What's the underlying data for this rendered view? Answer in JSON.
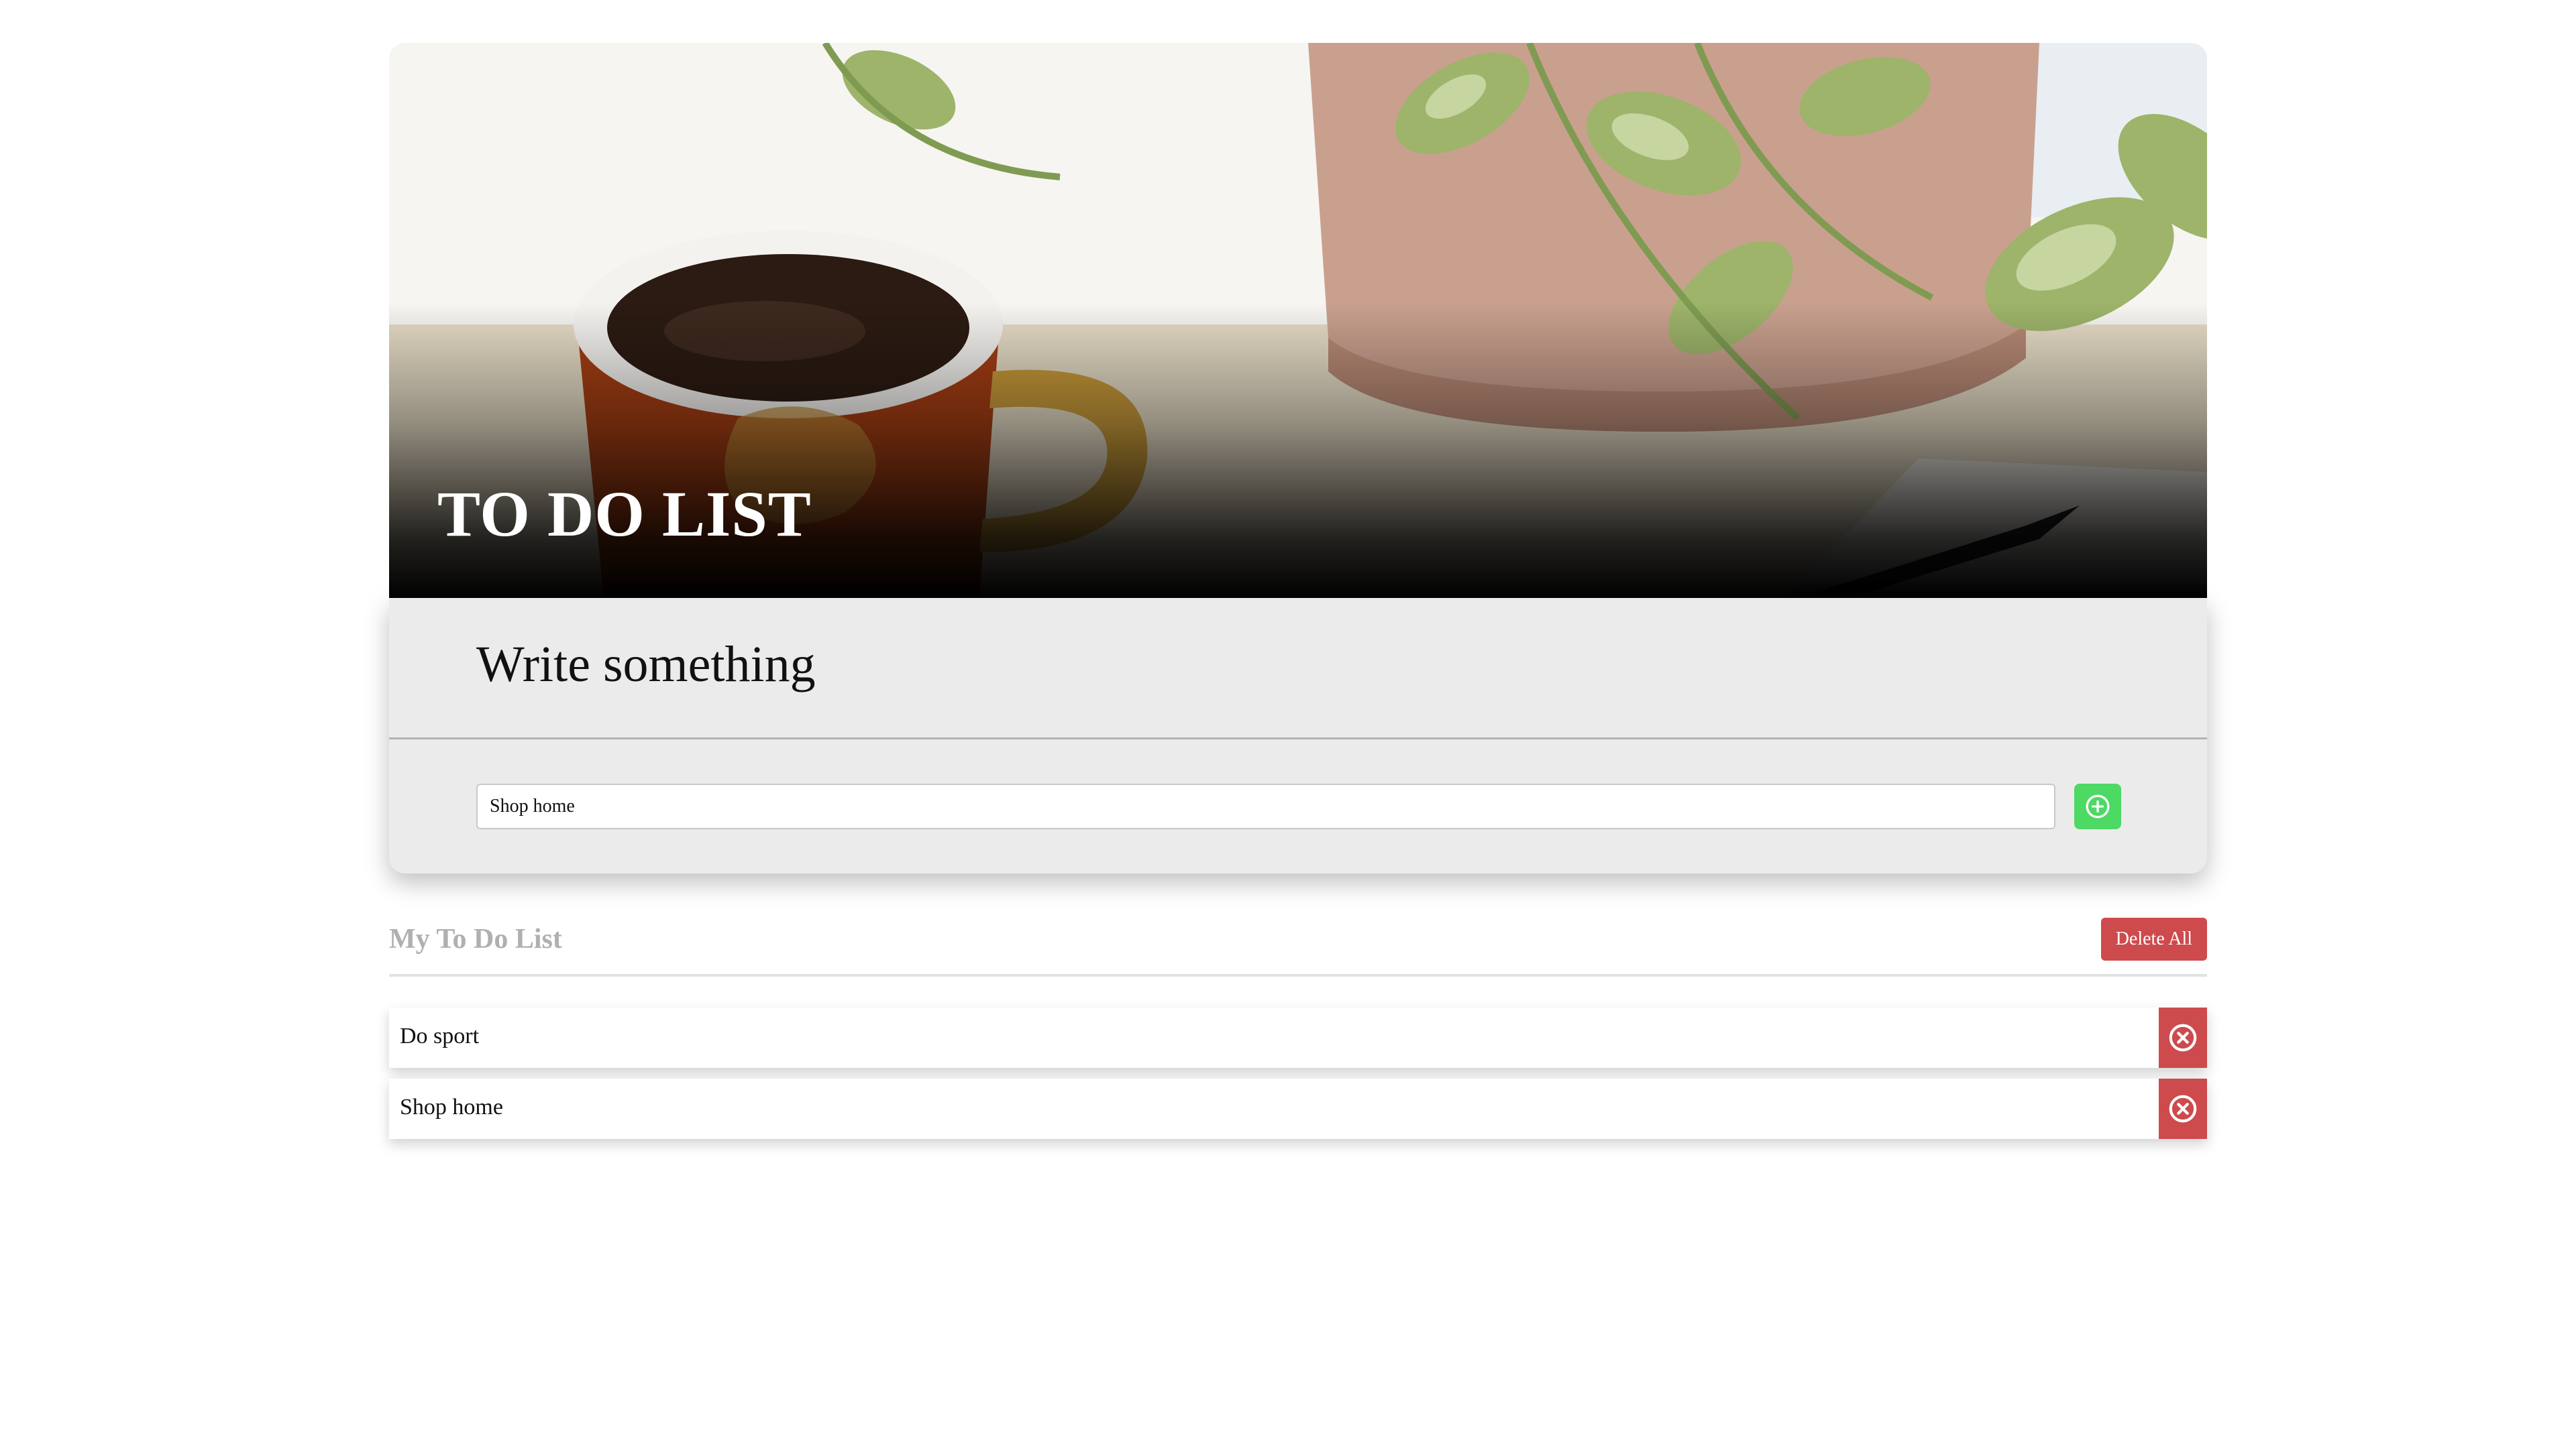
{
  "hero": {
    "title": "TO DO LIST"
  },
  "form": {
    "heading": "Write something",
    "input_value": "Shop home",
    "add_icon": "plus-circle-icon",
    "add_color": "#4cd964"
  },
  "list": {
    "heading": "My To Do List",
    "delete_all_label": "Delete All",
    "delete_color": "#cd4a4d",
    "remove_icon": "x-circle-icon",
    "items": [
      {
        "text": "Do sport"
      },
      {
        "text": "Shop home"
      }
    ]
  }
}
